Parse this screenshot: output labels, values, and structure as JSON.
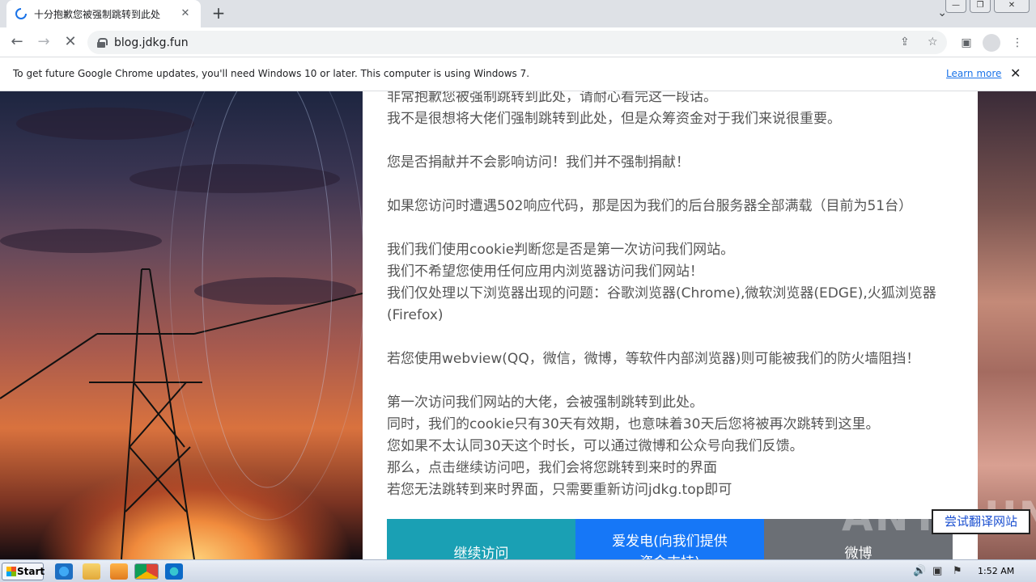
{
  "browser": {
    "tab_title": "十分抱歉您被强制跳转到此处",
    "tab_close": "✕",
    "new_tab": "+",
    "url": "blog.jdkg.fun",
    "window_minimize": "—",
    "window_restore": "❐",
    "window_close": "✕"
  },
  "infobar": {
    "message": "To get future Google Chrome updates, you'll need Windows 10 or later. This computer is using Windows 7.",
    "link": "Learn more",
    "close": "✕"
  },
  "page": {
    "paragraphs": [
      "非常抱歉您被强制跳转到此处，请耐心看完这一段话。",
      "我不是很想将大佬们强制跳转到此处，但是众筹资金对于我们来说很重要。",
      "",
      "您是否捐献并不会影响访问！我们并不强制捐献！",
      "",
      "如果您访问时遭遇502响应代码，那是因为我们的后台服务器全部满载（目前为51台）",
      "",
      "我们我们使用cookie判断您是否是第一次访问我们网站。",
      "我们不希望您使用任何应用内浏览器访问我们网站！",
      "我们仅处理以下浏览器出现的问题：谷歌浏览器(Chrome),微软浏览器(EDGE),火狐浏览器",
      "(Firefox)",
      "",
      "若您使用webview(QQ，微信，微博，等软件内部浏览器)则可能被我们的防火墙阻挡！",
      "",
      "第一次访问我们网站的大佬，会被强制跳转到此处。",
      "同时，我们的cookie只有30天有效期，也意味着30天后您将被再次跳转到这里。",
      "您如果不太认同30天这个时长，可以通过微博和公众号向我们反馈。",
      "那么，点击继续访问吧，我们会将您跳转到来时的界面",
      "若您无法跳转到来时界面，只需要重新访问jdkg.top即可"
    ],
    "buttons": {
      "continue": "继续访问",
      "donate_line1": "爱发电(向我们提供",
      "donate_line2": "资金支持)",
      "weibo": "微博"
    },
    "colors": {
      "continue": "#1aa0b4",
      "donate": "#1677f7",
      "weibo": "#6b6f75"
    },
    "translate_button": "尝试翻译网站",
    "watermark": "ANY.RUN"
  },
  "taskbar": {
    "start_label": "Start",
    "time": "1:52 AM"
  }
}
